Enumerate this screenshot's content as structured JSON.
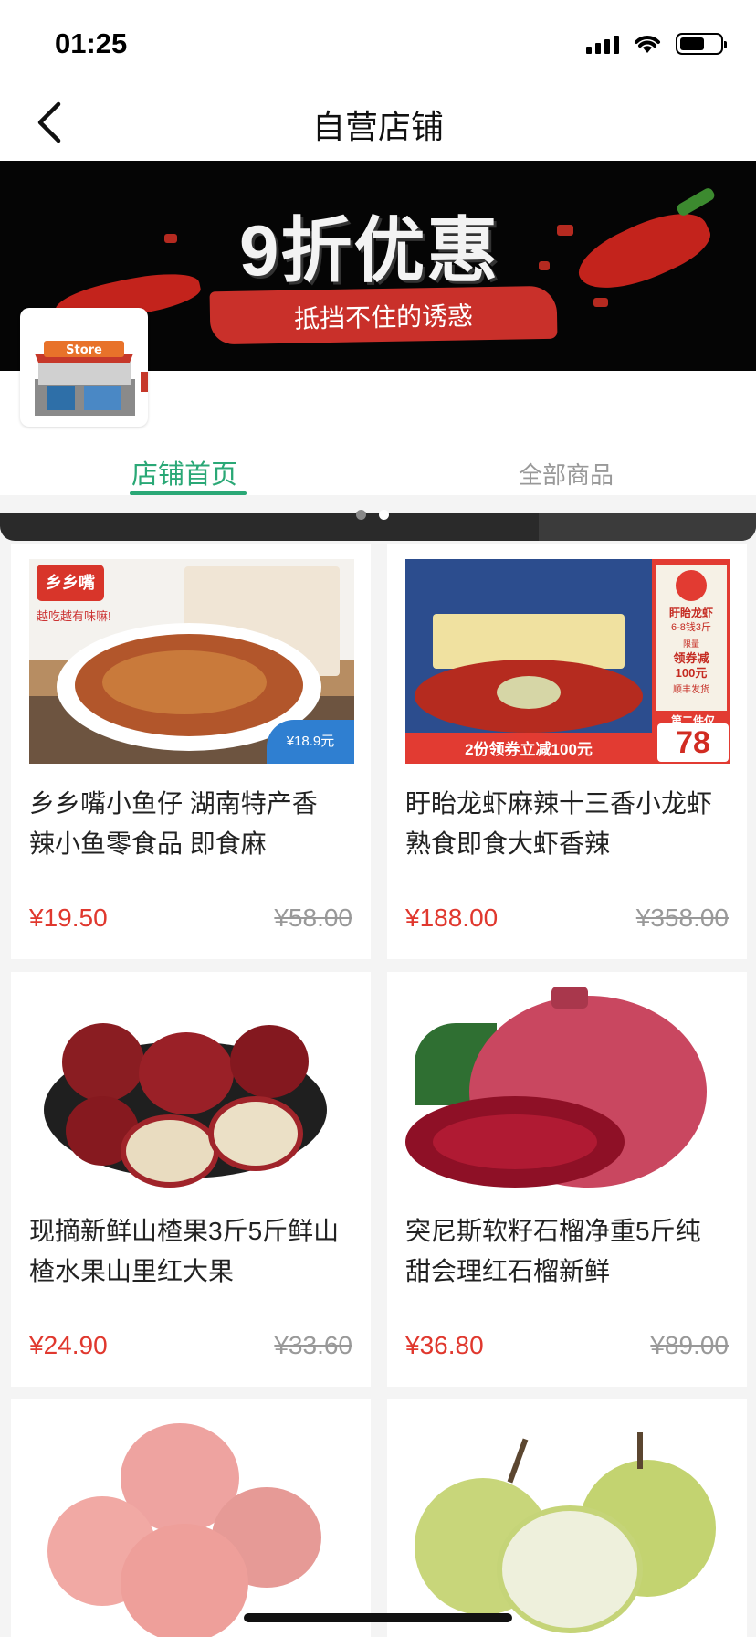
{
  "status_bar": {
    "time": "01:25"
  },
  "nav": {
    "title": "自营店铺"
  },
  "banner": {
    "headline": "9折优惠",
    "subline": "抵挡不住的诱惑"
  },
  "store": {
    "logo_label": "Store"
  },
  "tabs": [
    {
      "label": "店铺首页",
      "active": true
    },
    {
      "label": "全部商品",
      "active": false
    }
  ],
  "products": [
    {
      "title": "乡乡嘴小鱼仔 湖南特产香辣小鱼零食品 即食麻",
      "price": "¥19.50",
      "original_price": "¥58.00",
      "image_badge": "¥18.9元",
      "image_logo": "乡乡嘴",
      "image_slogan": "越吃越有味嘛!"
    },
    {
      "title": "盱眙龙虾麻辣十三香小龙虾熟食即食大虾香辣",
      "price": "¥188.00",
      "original_price": "¥358.00",
      "image_banner": "2份领券立减100元",
      "image_side_title": "盱眙龙虾",
      "image_side_spec": "6-8钱3斤",
      "image_side_limit": "限量",
      "image_side_coupon": "领券减",
      "image_side_coupon_amount": "100元",
      "image_side_shipping": "顺丰发货",
      "image_second_label": "第二件仅",
      "image_second_price": "78"
    },
    {
      "title": "现摘新鲜山楂果3斤5斤鲜山楂水果山里红大果",
      "price": "¥24.90",
      "original_price": "¥33.60"
    },
    {
      "title": "突尼斯软籽石榴净重5斤纯甜会理红石榴新鲜",
      "price": "¥36.80",
      "original_price": "¥89.00"
    },
    {
      "title": "",
      "price": "",
      "original_price": ""
    },
    {
      "title": "",
      "price": "",
      "original_price": ""
    }
  ],
  "colors": {
    "accent": "#2aa876",
    "price": "#e0382e",
    "muted": "#999999"
  }
}
